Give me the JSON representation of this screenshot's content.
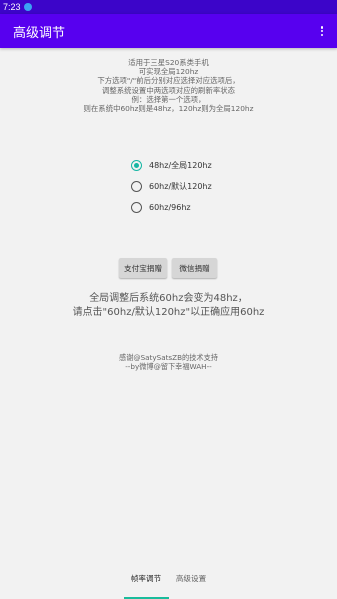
{
  "status_bar": {
    "time": "7:23"
  },
  "app_bar": {
    "title": "高级调节"
  },
  "intro_lines": [
    "适用于三星S20系类手机",
    "可实现全局120hz",
    "下方选项\"/\"前后分别对应选择对应选项后，",
    "调整系统设置中两选项对应的刷新率状态",
    "例：选择第一个选项，",
    "则在系统中60hz则是48hz，120hz则为全局120hz"
  ],
  "options": [
    {
      "label": "48hz/全局120hz",
      "checked": true
    },
    {
      "label": "60hz/默认120hz",
      "checked": false
    },
    {
      "label": "60hz/96hz",
      "checked": false
    }
  ],
  "donate": {
    "alipay": "支付宝捐赠",
    "wechat": "微信捐赠"
  },
  "notice_lines": [
    "全局调整后系统60hz会变为48hz，",
    "请点击\"60hz/默认120hz\"以正确应用60hz"
  ],
  "credits": [
    "感谢@SatySatsZB的技术支持",
    "--by微博@留下幸福WAH--"
  ],
  "bottom_nav": [
    {
      "label": "帧率调节",
      "active": true
    },
    {
      "label": "高级设置",
      "active": false
    }
  ],
  "colors": {
    "appbar": "#5700ef",
    "statusbar": "#3c05c9",
    "accent": "#16b6a4"
  }
}
